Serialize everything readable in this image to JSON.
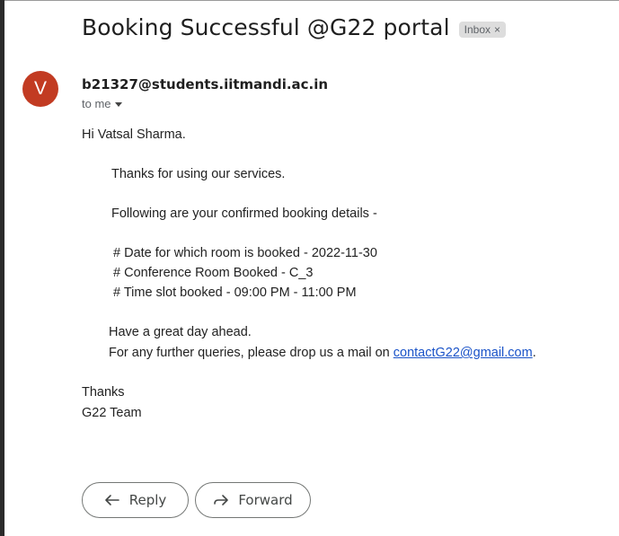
{
  "email": {
    "subject": "Booking Successful @G22 portal",
    "label_chip": "Inbox",
    "label_close": "×",
    "avatar_letter": "V",
    "avatar_color": "#c23b22",
    "sender": "b21327@students.iitmandi.ac.in",
    "recipient": "to me",
    "greeting": "Hi Vatsal Sharma.",
    "thanks_line": "Thanks for using our services.",
    "details_intro": "Following are your confirmed booking details -",
    "details": [
      "# Date for which room is booked - 2022-11-30",
      "# Conference Room Booked - C_3",
      "# Time slot booked - 09:00 PM - 11:00 PM"
    ],
    "closing_1": "Have a great day ahead.",
    "closing_2_prefix": "For any further queries, please drop us a mail on ",
    "contact_email": "contactG22@gmail.com",
    "closing_2_suffix": ".",
    "signoff_1": "Thanks",
    "signoff_2": "G22 Team"
  },
  "actions": {
    "reply_label": "Reply",
    "forward_label": "Forward"
  },
  "icons": {
    "reply": "reply-arrow-icon",
    "forward": "forward-arrow-icon",
    "dropdown": "chevron-down-icon"
  }
}
